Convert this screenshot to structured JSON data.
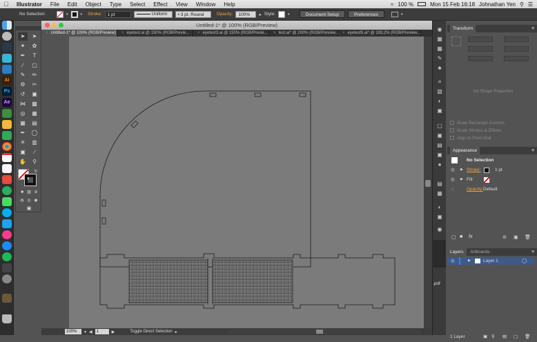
{
  "menubar": {
    "app": "Illustrator",
    "items": [
      "File",
      "Edit",
      "Object",
      "Type",
      "Select",
      "Effect",
      "View",
      "Window",
      "Help"
    ],
    "status": {
      "date_time": "Mon 15 Feb  16:18",
      "battery": "100 %",
      "user": "Johnathan Yen"
    }
  },
  "control_bar": {
    "selection": "No Selection",
    "stroke_label": "Stroke:",
    "stroke_weight": "1 pt",
    "brush": "Uniform",
    "profile": "3 pt. Round",
    "opacity_label": "Opacity:",
    "opacity_value": "100%",
    "style_label": "Style:",
    "document_setup": "Document Setup",
    "preferences": "Preferences"
  },
  "document": {
    "window_title": "Untitled-1* @ 100% (RGB/Preview)",
    "tabs": [
      {
        "label": "Untitled-1* @ 100% (RGB/Preview)",
        "active": true
      },
      {
        "label": "eyetest.ai @ 150% (RGB/Previe...",
        "active": false
      },
      {
        "label": "eyetest3.ai @ 150% (RGB/Previe...",
        "active": false
      },
      {
        "label": "test.ai* @ 200% (RGB/Preview...",
        "active": false
      },
      {
        "label": "eyetest5.ai* @ 183,2% (RGB/Preview...",
        "active": false
      }
    ],
    "status": {
      "zoom": "100%",
      "page": "1",
      "tool_hint": "Toggle Direct Selection"
    }
  },
  "transform_panel": {
    "tab": "Transform",
    "empty_message": "No Shape Properties",
    "options": [
      "Scale Rectangle Corners",
      "Scale Strokes & Effects",
      "Align to Pixel Grid"
    ]
  },
  "appearance_panel": {
    "tab": "Appearance",
    "selection": "No Selection",
    "stroke_label": "Stroke:",
    "stroke_value": "1 pt",
    "fill_label": "Fill:",
    "opacity_label": "Opacity:",
    "opacity_value": "Default"
  },
  "layers_panel": {
    "tabs": [
      "Layers",
      "Artboards"
    ],
    "layers": [
      {
        "name": "Layer 1"
      }
    ],
    "footer": "1 Layer"
  },
  "background_fragment": ".pdf",
  "colors": {
    "canvas": "#7b7b7b",
    "ui_dark": "#535353",
    "accent_orange": "#f5a23a",
    "layer_highlight": "#3d5a8a"
  }
}
